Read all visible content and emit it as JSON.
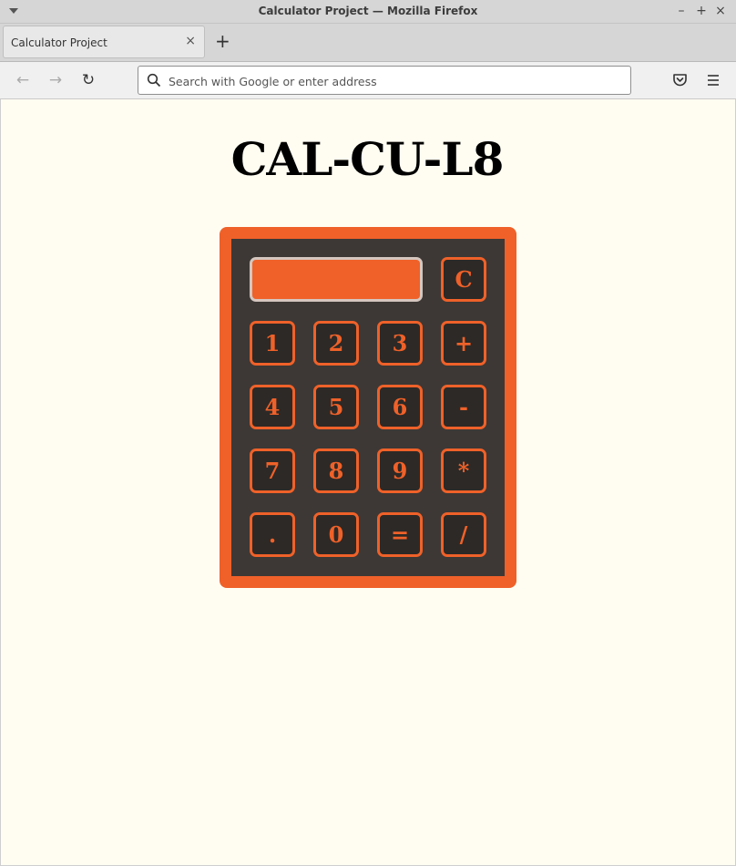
{
  "window": {
    "title": "Calculator Project — Mozilla Firefox"
  },
  "tabs": [
    {
      "label": "Calculator Project",
      "active": true
    }
  ],
  "navbar": {
    "url_placeholder": "Search with Google or enter address"
  },
  "page": {
    "heading": "CAL-CU-L8",
    "display_value": ""
  },
  "calculator": {
    "clear_label": "C",
    "keys": [
      [
        "1",
        "2",
        "3",
        "+"
      ],
      [
        "4",
        "5",
        "6",
        "-"
      ],
      [
        "7",
        "8",
        "9",
        "*"
      ],
      [
        ".",
        "0",
        "=",
        "/"
      ]
    ]
  },
  "colors": {
    "page_background": "#fffdf2",
    "accent": "#ef6129",
    "calc_body": "#3d3835",
    "key_background": "#2d2926"
  }
}
